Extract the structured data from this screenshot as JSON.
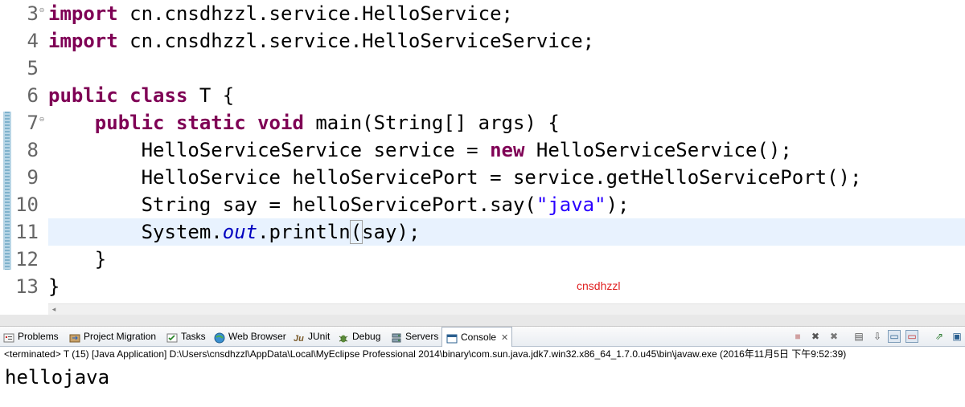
{
  "editor": {
    "lines": [
      {
        "num": "3",
        "fold": "⊖",
        "tokens": [
          {
            "t": "import",
            "k": "kw"
          },
          {
            "t": " cn.cnsdhzzl.service.HelloService;"
          }
        ]
      },
      {
        "num": "4",
        "fold": "",
        "tokens": [
          {
            "t": "import",
            "k": "kw"
          },
          {
            "t": " cn.cnsdhzzl.service.HelloServiceService;"
          }
        ]
      },
      {
        "num": "5",
        "fold": "",
        "tokens": []
      },
      {
        "num": "6",
        "fold": "",
        "tokens": [
          {
            "t": "public",
            "k": "kw"
          },
          {
            "t": " "
          },
          {
            "t": "class",
            "k": "kw"
          },
          {
            "t": " T {"
          }
        ]
      },
      {
        "num": "7",
        "fold": "⊖",
        "tokens": [
          {
            "t": "    "
          },
          {
            "t": "public",
            "k": "kw"
          },
          {
            "t": " "
          },
          {
            "t": "static",
            "k": "kw"
          },
          {
            "t": " "
          },
          {
            "t": "void",
            "k": "kw"
          },
          {
            "t": " main(String[] args) {"
          }
        ]
      },
      {
        "num": "8",
        "fold": "",
        "tokens": [
          {
            "t": "        HelloServiceService service = "
          },
          {
            "t": "new",
            "k": "kw"
          },
          {
            "t": " HelloServiceService();"
          }
        ]
      },
      {
        "num": "9",
        "fold": "",
        "tokens": [
          {
            "t": "        HelloService helloServicePort = service.getHelloServicePort();"
          }
        ]
      },
      {
        "num": "10",
        "fold": "",
        "tokens": [
          {
            "t": "        String say = helloServicePort.say("
          },
          {
            "t": "\"java\"",
            "k": "str"
          },
          {
            "t": ");"
          }
        ]
      },
      {
        "num": "11",
        "fold": "",
        "current": true,
        "tokens": [
          {
            "t": "        System."
          },
          {
            "t": "out",
            "k": "fld"
          },
          {
            "t": ".println"
          },
          {
            "t": "(",
            "k": "bracket"
          },
          {
            "t": "say);"
          }
        ]
      },
      {
        "num": "12",
        "fold": "",
        "tokens": [
          {
            "t": "    }"
          }
        ]
      },
      {
        "num": "13",
        "fold": "",
        "tokens": [
          {
            "t": "}"
          }
        ]
      }
    ],
    "watermark": "cnsdhzzl"
  },
  "views": {
    "tabs": [
      {
        "label": "Problems",
        "icon": "problems-icon"
      },
      {
        "label": "Project Migration",
        "icon": "project-migration-icon"
      },
      {
        "label": "Tasks",
        "icon": "tasks-icon"
      },
      {
        "label": "Web Browser",
        "icon": "web-browser-icon"
      },
      {
        "label": "JUnit",
        "icon": "junit-icon"
      },
      {
        "label": "Debug",
        "icon": "debug-icon"
      },
      {
        "label": "Servers",
        "icon": "servers-icon"
      },
      {
        "label": "Console",
        "icon": "console-icon",
        "active": true,
        "close": "✕"
      }
    ],
    "console_status": "<terminated> T (15) [Java Application] D:\\Users\\cnsdhzzl\\AppData\\Local\\MyEclipse Professional 2014\\binary\\com.sun.java.jdk7.win32.x86_64_1.7.0.u45\\bin\\javaw.exe (2016年11月5日 下午9:52:39)",
    "console_output": "hellojava"
  },
  "colors": {
    "keyword": "#7f0055",
    "string": "#2a00ff",
    "field": "#0000c0",
    "current_line": "#e8f2fe",
    "watermark": "#e02020"
  }
}
